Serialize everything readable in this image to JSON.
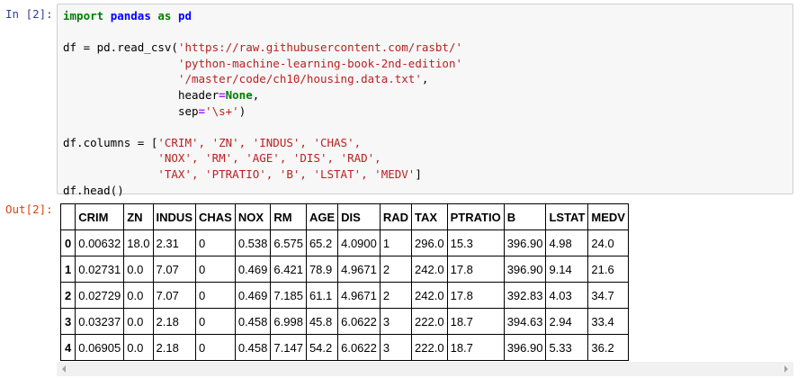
{
  "input_prompt": "In [2]:",
  "output_prompt": "Out[2]:",
  "code": {
    "kw_import": "import",
    "mod_pandas": "pandas",
    "kw_as": "as",
    "alias_pd": "pd",
    "line3_pre": "df = pd.read_csv(",
    "url_part1": "'https://raw.githubusercontent.com/rasbt/'",
    "url_part2": "'python-machine-learning-book-2nd-edition'",
    "url_part3": "'/master/code/ch10/housing.data.txt'",
    "line6_tail": ",",
    "header_kw": "header",
    "eq": "=",
    "none_const": "None",
    "sep_kw": "sep",
    "sep_val": "'\\s+'",
    "close_paren": ")",
    "columns_pre": "df.columns = [",
    "cols_line1": "'CRIM', 'ZN', 'INDUS', 'CHAS',",
    "cols_line2": "'NOX', 'RM', 'AGE', 'DIS', 'RAD',",
    "cols_line3": "'TAX', 'PTRATIO', 'B', 'LSTAT', 'MEDV'",
    "cols_close": "]",
    "head_call": "df.head()"
  },
  "table": {
    "columns": [
      "CRIM",
      "ZN",
      "INDUS",
      "CHAS",
      "NOX",
      "RM",
      "AGE",
      "DIS",
      "RAD",
      "TAX",
      "PTRATIO",
      "B",
      "LSTAT",
      "MEDV"
    ],
    "rows": [
      {
        "index": "0",
        "values": [
          "0.00632",
          "18.0",
          "2.31",
          "0",
          "0.538",
          "6.575",
          "65.2",
          "4.0900",
          "1",
          "296.0",
          "15.3",
          "396.90",
          "4.98",
          "24.0"
        ]
      },
      {
        "index": "1",
        "values": [
          "0.02731",
          "0.0",
          "7.07",
          "0",
          "0.469",
          "6.421",
          "78.9",
          "4.9671",
          "2",
          "242.0",
          "17.8",
          "396.90",
          "9.14",
          "21.6"
        ]
      },
      {
        "index": "2",
        "values": [
          "0.02729",
          "0.0",
          "7.07",
          "0",
          "0.469",
          "7.185",
          "61.1",
          "4.9671",
          "2",
          "242.0",
          "17.8",
          "392.83",
          "4.03",
          "34.7"
        ]
      },
      {
        "index": "3",
        "values": [
          "0.03237",
          "0.0",
          "2.18",
          "0",
          "0.458",
          "6.998",
          "45.8",
          "6.0622",
          "3",
          "222.0",
          "18.7",
          "394.63",
          "2.94",
          "33.4"
        ]
      },
      {
        "index": "4",
        "values": [
          "0.06905",
          "0.0",
          "2.18",
          "0",
          "0.458",
          "7.147",
          "54.2",
          "6.0622",
          "3",
          "222.0",
          "18.7",
          "396.90",
          "5.33",
          "36.2"
        ]
      }
    ]
  },
  "scrollbar": {
    "left_icon": "triangle-left-icon",
    "right_icon": "triangle-right-icon"
  }
}
